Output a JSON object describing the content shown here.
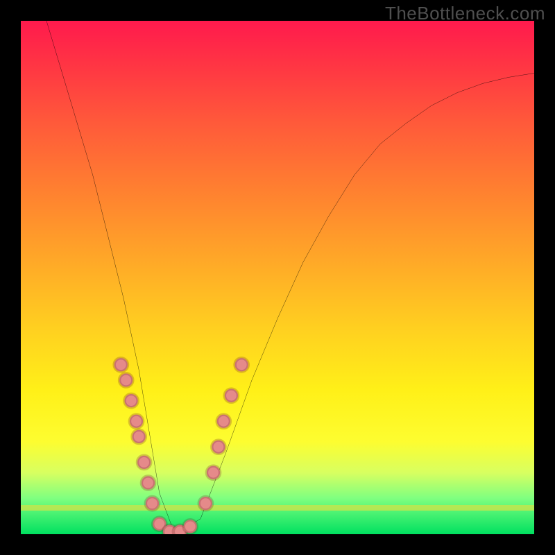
{
  "watermark": "TheBottleneck.com",
  "chart_data": {
    "type": "line",
    "title": "",
    "xlabel": "",
    "ylabel": "",
    "xlim": [
      0,
      100
    ],
    "ylim": [
      0,
      100
    ],
    "grid": false,
    "legend": false,
    "series": [
      {
        "name": "bottleneck_curve",
        "x": [
          5,
          8,
          11,
          14,
          17,
          20,
          23,
          25,
          27,
          30,
          35,
          40,
          45,
          50,
          55,
          60,
          65,
          70,
          75,
          80,
          85,
          90,
          95,
          100
        ],
        "y": [
          100,
          90,
          80,
          70,
          58,
          46,
          32,
          20,
          8,
          0,
          3,
          16,
          30,
          42,
          53,
          62,
          70,
          76,
          80,
          83.5,
          86,
          87.8,
          89,
          89.8
        ]
      }
    ],
    "annotations": [
      {
        "name": "dots_left_branch",
        "points": [
          {
            "x": 19.5,
            "y": 33
          },
          {
            "x": 20.5,
            "y": 30
          },
          {
            "x": 21.5,
            "y": 26
          },
          {
            "x": 22.5,
            "y": 22
          },
          {
            "x": 23,
            "y": 19
          },
          {
            "x": 24,
            "y": 14
          },
          {
            "x": 24.8,
            "y": 10
          },
          {
            "x": 25.6,
            "y": 6
          },
          {
            "x": 27,
            "y": 2
          },
          {
            "x": 29,
            "y": 0.5
          },
          {
            "x": 31,
            "y": 0.5
          },
          {
            "x": 33,
            "y": 1.5
          }
        ]
      },
      {
        "name": "dots_right_branch",
        "points": [
          {
            "x": 36,
            "y": 6
          },
          {
            "x": 37.5,
            "y": 12
          },
          {
            "x": 38.5,
            "y": 17
          },
          {
            "x": 39.5,
            "y": 22
          },
          {
            "x": 41,
            "y": 27
          },
          {
            "x": 43,
            "y": 33
          }
        ]
      }
    ]
  }
}
